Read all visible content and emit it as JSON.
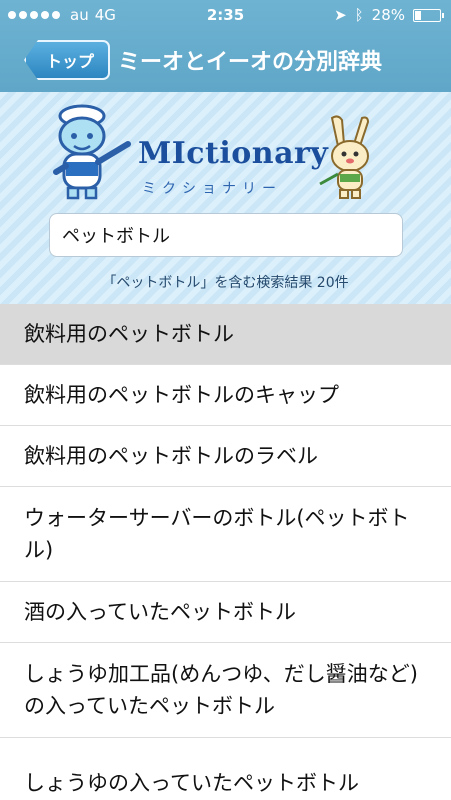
{
  "status_bar": {
    "carrier": "au",
    "network": "4G",
    "time": "2:35",
    "battery_percent": "28%",
    "battery_level": 0.28
  },
  "navbar": {
    "back_label": "トップ",
    "title": "ミーオとイーオの分別辞典"
  },
  "banner": {
    "logo_text": "MIctionary",
    "logo_subtitle": "ミクショナリー"
  },
  "search": {
    "value": "ペットボトル"
  },
  "result_text": "「ペットボトル」を含む検索結果 20件",
  "results": [
    {
      "label": "飲料用のペットボトル",
      "selected": true
    },
    {
      "label": "飲料用のペットボトルのキャップ"
    },
    {
      "label": "飲料用のペットボトルのラベル"
    },
    {
      "label": "ウォーターサーバーのボトル(ペットボトル)"
    },
    {
      "label": "酒の入っていたペットボトル"
    },
    {
      "label": "しょうゆ加工品(めんつゆ、だし醤油など)の入っていたペットボトル"
    },
    {
      "label": "しょうゆの入っていたペットボトル"
    }
  ],
  "colors": {
    "header": "#6fb3d2",
    "back_button": "#2d86c1",
    "logo": "#1b4e9c",
    "selected_row": "#d9d9d9"
  }
}
